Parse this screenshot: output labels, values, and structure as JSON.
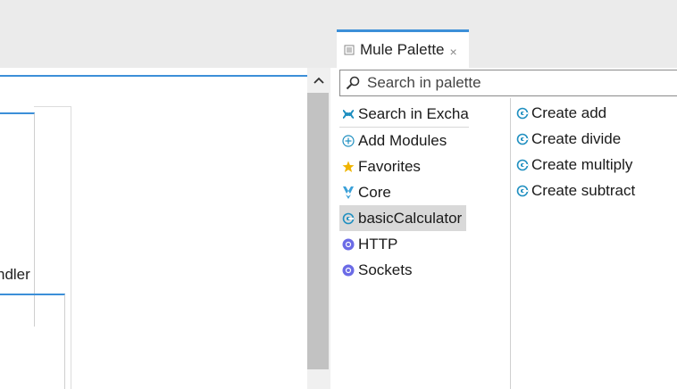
{
  "palette": {
    "tab_title": "Mule Palette",
    "tab_close": "×",
    "search_placeholder": "Search in palette",
    "categories": [
      {
        "label": "Search in Exchange...",
        "icon": "exchange-icon"
      },
      {
        "label": "Add Modules",
        "icon": "add-circle-icon"
      },
      {
        "label": "Favorites",
        "icon": "star-icon"
      },
      {
        "label": "Core",
        "icon": "core-icon"
      },
      {
        "label": "basicCalculator",
        "icon": "connector-icon",
        "selected": true
      },
      {
        "label": "HTTP",
        "icon": "module-icon"
      },
      {
        "label": "Sockets",
        "icon": "module-icon"
      }
    ],
    "operations": [
      {
        "label": "Create add",
        "icon": "operation-icon"
      },
      {
        "label": "Create divide",
        "icon": "operation-icon"
      },
      {
        "label": "Create multiply",
        "icon": "operation-icon"
      },
      {
        "label": "Create subtract",
        "icon": "operation-icon"
      }
    ]
  },
  "canvas": {
    "handler_label_fragment": "ndler"
  },
  "colors": {
    "accent": "#3c8fd8",
    "icon_teal": "#1f8fc0",
    "icon_purple": "#6b6be6",
    "star": "#f0b400",
    "selection": "#d9d9d9"
  }
}
